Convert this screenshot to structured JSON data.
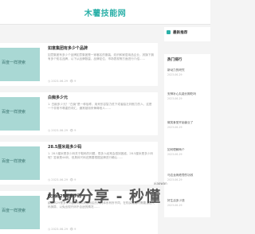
{
  "header": {
    "logo": "木薯技能网"
  },
  "articles": [
    {
      "title": "如意集团有多少个品牌",
      "excerpt": "如意集团有多少个品牌如意集团是一家著名的服装、纺织和家居用品企业，其旗下拥有多个知名品牌，以下从品牌数量、品牌定位、市场表现等方面进行介绍……",
      "thumb": "百度一样搜索",
      "date": "2023-06-29",
      "views": "9"
    },
    {
      "title": "白痴多少元",
      "excerpt": "1. 白痴多少元？“白痴”是一种俗称，用来形容智力低下或者缺乏判断力的人，这是一个非常不尊重的词汇，通常被用来侮辱他人……",
      "thumb": "百度一样搜索",
      "date": "2023-06-29",
      "views": "9"
    },
    {
      "title": "28.5厘米是多少码",
      "excerpt": "1. 28.5厘米是多少码关于鞋码的问题，很多人经常会感到困惑，28.5厘米是多少码呢？答案是44码，但具体尺码还需要根据品牌进行确认……",
      "thumb": "百度一样搜索",
      "date": "2023-06-29",
      "views": "9"
    },
    {
      "title": "欧洲码29是多少码",
      "excerpt": "欧洲码29是多少码欧洲码和其他地区的尺码体系有所不同，在购买服装时需要注意尺码换算，以免出现尺码不合适的情况……",
      "thumb": "百度一样搜索",
      "date": "2023-06-29",
      "views": "9"
    }
  ],
  "sidebar": {
    "recommend_title": "最新推荐",
    "hot_title": "热门排行",
    "hot_items": [
      {
        "title": "新动力的研究",
        "date": "2023-06-29"
      },
      {
        "title": "安神补心丸能长期吃吗",
        "date": "2023-06-29"
      },
      {
        "title": "微笑食堂开始营业了",
        "date": "2023-06-29"
      },
      {
        "title": "如何理解两个",
        "date": "2023-06-29"
      },
      {
        "title": "马应龙痔疮膏的功效",
        "date": "2023-06-29"
      },
      {
        "title": "好生活多少钱",
        "date": "2023-06-29"
      }
    ]
  },
  "watermark": {
    "text": "小玩分享 - 秒懂",
    "sub": "xiaowan"
  }
}
